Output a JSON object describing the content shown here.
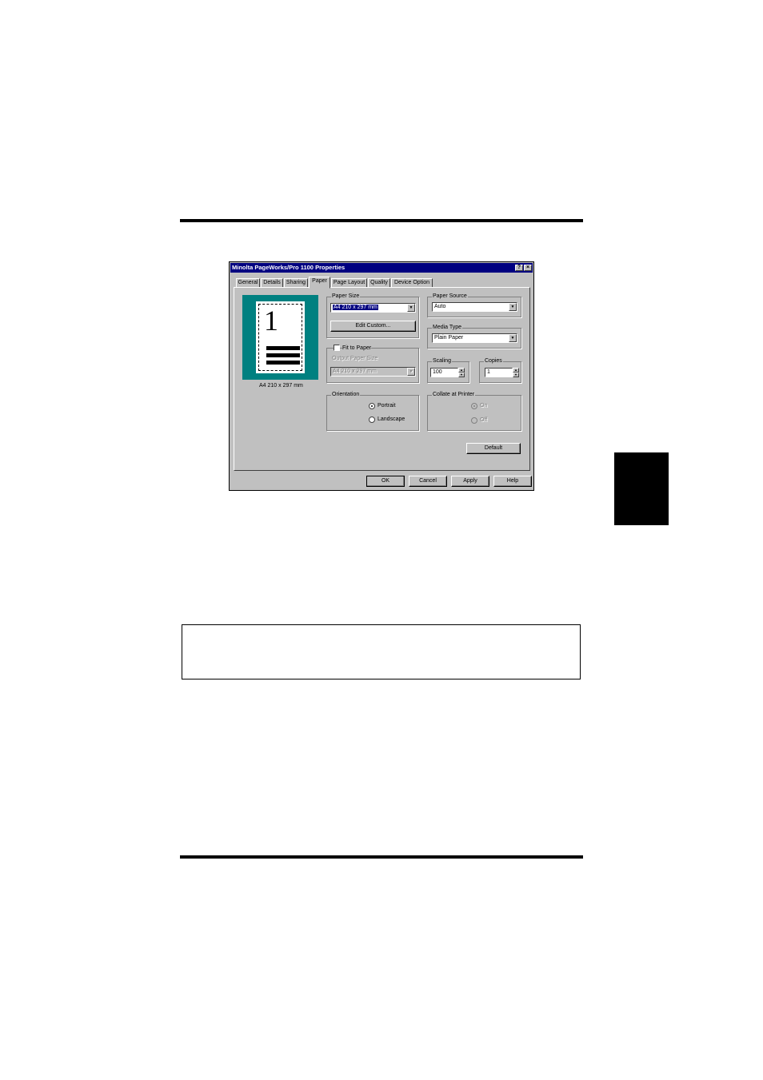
{
  "dialog": {
    "title": "Minolta PageWorks/Pro 1100 Properties",
    "help_button": "?",
    "close_button": "×",
    "tabs": [
      "General",
      "Details",
      "Sharing",
      "Paper",
      "Page Layout",
      "Quality",
      "Device Option"
    ],
    "active_tab": "Paper",
    "preview": {
      "number": "1",
      "caption": "A4 210 x 297 mm"
    },
    "paper_size": {
      "label": "Paper Size",
      "value": "A4 210 x 297 mm",
      "edit_custom": "Edit Custom...",
      "fit_to_paper": "Fit to Paper",
      "output_paper_size_label": "Output Paper Size",
      "output_paper_size_value": "A4 210 x 297 mm"
    },
    "paper_source": {
      "label": "Paper Source",
      "value": "Auto"
    },
    "media_type": {
      "label": "Media Type",
      "value": "Plain Paper"
    },
    "scaling": {
      "label": "Scaling",
      "value": "100"
    },
    "copies": {
      "label": "Copies",
      "value": "1"
    },
    "orientation": {
      "label": "Orientation",
      "portrait": "Portrait",
      "landscape": "Landscape",
      "selected": "Portrait"
    },
    "collate": {
      "label": "Collate at Printer",
      "on": "On",
      "off": "Off"
    },
    "default_button": "Default",
    "buttons": {
      "ok": "OK",
      "cancel": "Cancel",
      "apply": "Apply",
      "help": "Help"
    }
  }
}
